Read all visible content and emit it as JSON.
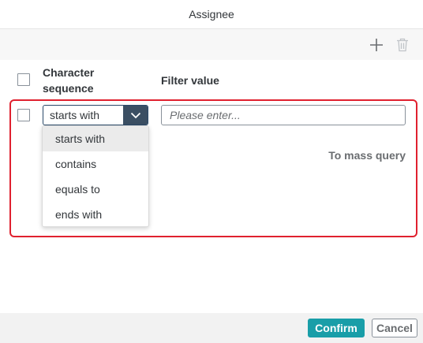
{
  "dialog": {
    "title": "Assignee"
  },
  "toolbar": {
    "add_icon": "plus-icon",
    "delete_icon": "trash-icon"
  },
  "table": {
    "headers": {
      "character_sequence": "Character sequence",
      "filter_value": "Filter value"
    },
    "row": {
      "operator_selected": "starts with",
      "filter_placeholder": "Please enter...",
      "filter_value": ""
    }
  },
  "dropdown": {
    "options": [
      "starts with",
      "contains",
      "equals to",
      "ends with"
    ],
    "selected": "starts with"
  },
  "mass_query_label": "To mass query",
  "footer": {
    "confirm_label": "Confirm",
    "cancel_label": "Cancel"
  },
  "colors": {
    "accent": "#199ea8",
    "highlight_frame": "#e0212f",
    "select_button": "#3b4f63"
  }
}
